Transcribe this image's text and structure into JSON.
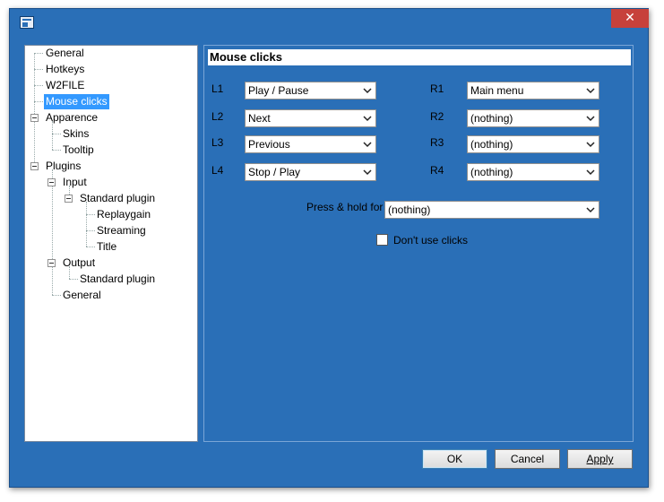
{
  "window": {
    "close_glyph": "✕"
  },
  "tree": {
    "general": "General",
    "hotkeys": "Hotkeys",
    "w2file": "W2FILE",
    "mouse_clicks": "Mouse clicks",
    "apparence": "Apparence",
    "skins": "Skins",
    "tooltip": "Tooltip",
    "plugins": "Plugins",
    "input": "Input",
    "standard_plugin_input": "Standard plugin",
    "replaygain": "Replaygain",
    "streaming": "Streaming",
    "title": "Title",
    "output": "Output",
    "standard_plugin_output": "Standard plugin",
    "general2": "General"
  },
  "panel": {
    "title": "Mouse clicks",
    "l1_label": "L1",
    "l1_value": "Play / Pause",
    "l2_label": "L2",
    "l2_value": "Next",
    "l3_label": "L3",
    "l3_value": "Previous",
    "l4_label": "L4",
    "l4_value": "Stop / Play",
    "r1_label": "R1",
    "r1_value": "Main menu",
    "r2_label": "R2",
    "r2_value": "(nothing)",
    "r3_label": "R3",
    "r3_value": "(nothing)",
    "r4_label": "R4",
    "r4_value": "(nothing)",
    "press_hold_label": "Press & hold for :",
    "press_hold_value": "(nothing)",
    "dont_use_clicks_label": "Don't use clicks",
    "dont_use_clicks_checked": false
  },
  "buttons": {
    "ok": "OK",
    "cancel": "Cancel",
    "apply": "Apply"
  },
  "colors": {
    "window_bg": "#2a6fb7",
    "selection": "#3399ff",
    "close": "#c7413b"
  }
}
